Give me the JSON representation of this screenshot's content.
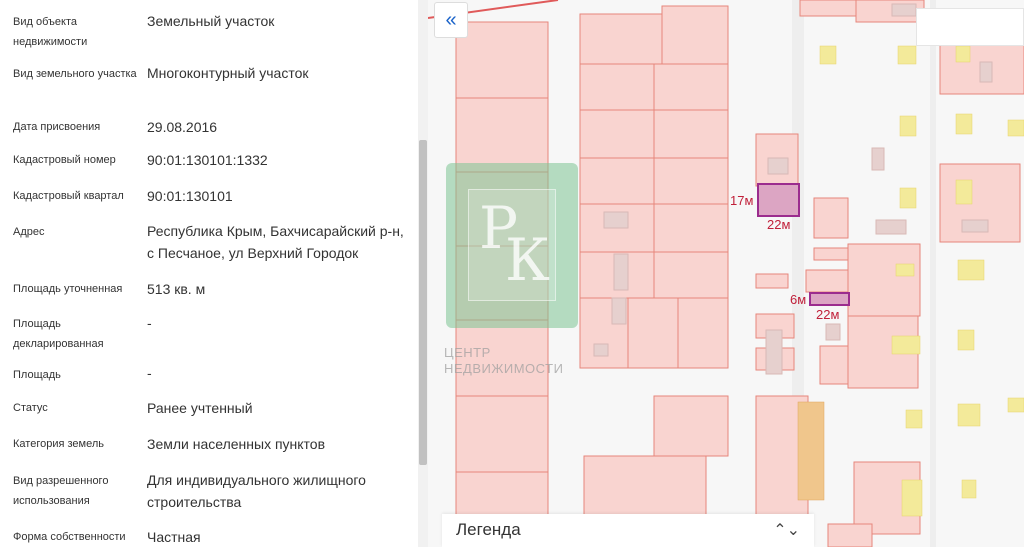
{
  "details": [
    {
      "label": "Вид объекта недвижимости",
      "value": "Земельный участок"
    },
    {
      "label": "Вид земельного участка",
      "value": "Многоконтурный участок"
    },
    {
      "label": "Дата присвоения",
      "value": "29.08.2016"
    },
    {
      "label": "Кадастровый номер",
      "value": "90:01:130101:1332"
    },
    {
      "label": "Кадастровый квартал",
      "value": "90:01:130101"
    },
    {
      "label": "Адрес",
      "value": "Республика Крым, Бахчисарайский р-н, с Песчаное, ул Верхний Городок"
    },
    {
      "label": "Площадь уточненная",
      "value": "513 кв. м"
    },
    {
      "label": "Площадь декларированная",
      "value": "-"
    },
    {
      "label": "Площадь",
      "value": "-"
    },
    {
      "label": "Статус",
      "value": "Ранее учтенный"
    },
    {
      "label": "Категория земель",
      "value": "Земли населенных пунктов"
    },
    {
      "label": "Вид разрешенного использования",
      "value": "Для индивидуального жилищного строительства"
    },
    {
      "label": "Форма собственности",
      "value": "Частная"
    }
  ],
  "map": {
    "collapse_icon": "double-chevron-left-icon",
    "collapse_glyph": "«",
    "legend_title": "Легенда",
    "legend_toggle_icon": "chevron-up-down-icon",
    "legend_toggle_glyph": "⌃⌄",
    "dimensions": {
      "plot1_width": "17м",
      "plot1_length": "22м",
      "plot2_width": "6м",
      "plot2_length": "22м"
    },
    "watermark": {
      "letter_p": "Р",
      "letter_k": "К",
      "line1": "ЦЕНТР",
      "line2": "НЕДВИЖИМОСТИ"
    },
    "colors": {
      "parcel_fill": "#f9d4d0",
      "parcel_stroke": "#e6867b",
      "building_fill": "#e6d0ce",
      "selected_fill": "#dca5c3",
      "selected_stroke": "#9b2c8e",
      "yellow_fill": "#f3ea9a",
      "dimension_text": "#c0203a"
    }
  }
}
